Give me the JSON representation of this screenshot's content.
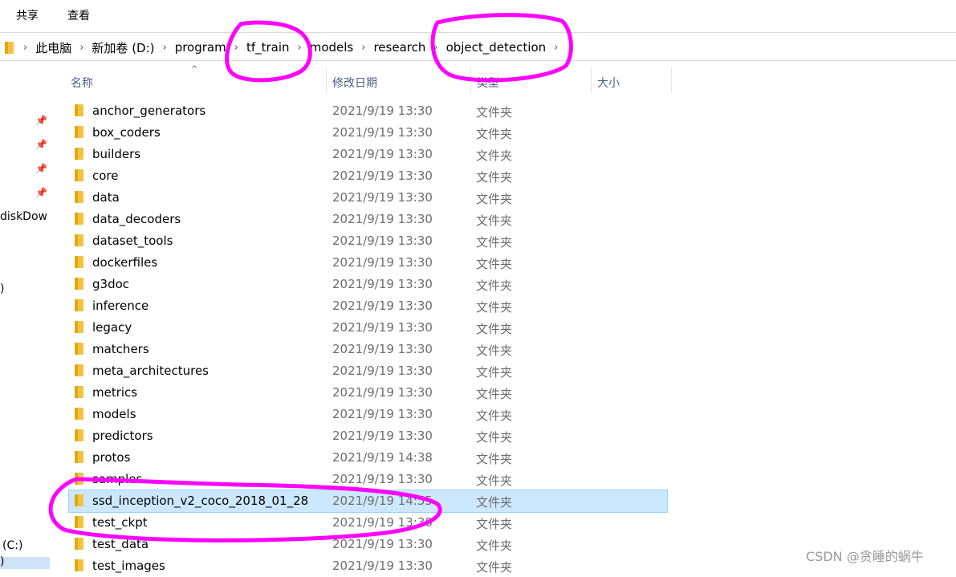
{
  "ribbon": {
    "tabs": [
      "共享",
      "查看"
    ]
  },
  "address_bar": {
    "crumbs": [
      "此电脑",
      "新加卷 (D:)",
      "program",
      "tf_train",
      "models",
      "research",
      "object_detection"
    ]
  },
  "nav_pane": {
    "labels": [
      "diskDow",
      ")",
      "(C:)",
      ")"
    ]
  },
  "columns": {
    "name": "名称",
    "date": "修改日期",
    "type": "类型",
    "size": "大小"
  },
  "files": [
    {
      "name": "anchor_generators",
      "date": "2021/9/19 13:30",
      "type": "文件夹"
    },
    {
      "name": "box_coders",
      "date": "2021/9/19 13:30",
      "type": "文件夹"
    },
    {
      "name": "builders",
      "date": "2021/9/19 13:30",
      "type": "文件夹"
    },
    {
      "name": "core",
      "date": "2021/9/19 13:30",
      "type": "文件夹"
    },
    {
      "name": "data",
      "date": "2021/9/19 13:30",
      "type": "文件夹"
    },
    {
      "name": "data_decoders",
      "date": "2021/9/19 13:30",
      "type": "文件夹"
    },
    {
      "name": "dataset_tools",
      "date": "2021/9/19 13:30",
      "type": "文件夹"
    },
    {
      "name": "dockerfiles",
      "date": "2021/9/19 13:30",
      "type": "文件夹"
    },
    {
      "name": "g3doc",
      "date": "2021/9/19 13:30",
      "type": "文件夹"
    },
    {
      "name": "inference",
      "date": "2021/9/19 13:30",
      "type": "文件夹"
    },
    {
      "name": "legacy",
      "date": "2021/9/19 13:30",
      "type": "文件夹"
    },
    {
      "name": "matchers",
      "date": "2021/9/19 13:30",
      "type": "文件夹"
    },
    {
      "name": "meta_architectures",
      "date": "2021/9/19 13:30",
      "type": "文件夹"
    },
    {
      "name": "metrics",
      "date": "2021/9/19 13:30",
      "type": "文件夹"
    },
    {
      "name": "models",
      "date": "2021/9/19 13:30",
      "type": "文件夹"
    },
    {
      "name": "predictors",
      "date": "2021/9/19 13:30",
      "type": "文件夹"
    },
    {
      "name": "protos",
      "date": "2021/9/19 14:38",
      "type": "文件夹"
    },
    {
      "name": "samples",
      "date": "2021/9/19 13:30",
      "type": "文件夹"
    },
    {
      "name": "ssd_inception_v2_coco_2018_01_28",
      "date": "2021/9/19 14:55",
      "type": "文件夹",
      "selected": true
    },
    {
      "name": "test_ckpt",
      "date": "2021/9/19 13:30",
      "type": "文件夹"
    },
    {
      "name": "test_data",
      "date": "2021/9/19 13:30",
      "type": "文件夹"
    },
    {
      "name": "test_images",
      "date": "2021/9/19 13:30",
      "type": "文件夹"
    }
  ],
  "colors": {
    "annotation": "#ff00ff",
    "selection": "#cce8ff",
    "header_text": "#4d6082"
  },
  "watermark": "CSDN @贪睡的蜗牛"
}
